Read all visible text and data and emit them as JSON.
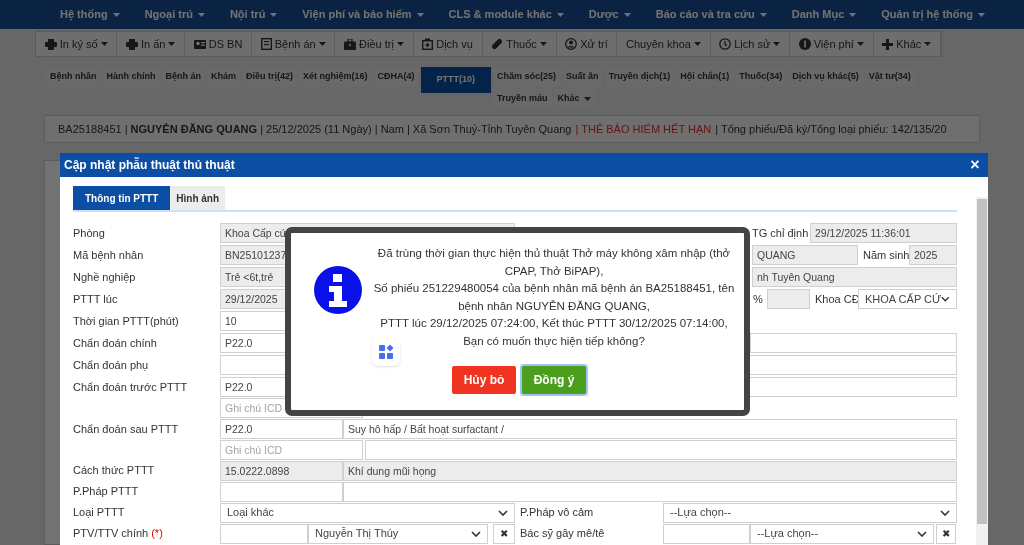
{
  "menu": [
    {
      "label": "Hệ thống"
    },
    {
      "label": "Ngoại trú"
    },
    {
      "label": "Nội trú"
    },
    {
      "label": "Viện phí và bảo hiểm"
    },
    {
      "label": "CLS & module khác"
    },
    {
      "label": "Dược"
    },
    {
      "label": "Báo cáo và tra cứu"
    },
    {
      "label": "Danh Mục"
    },
    {
      "label": "Quản trị hệ thống"
    }
  ],
  "toolbar": [
    {
      "label": "In ký số",
      "dropdown": true
    },
    {
      "label": "In ấn",
      "dropdown": true
    },
    {
      "label": "DS BN",
      "dropdown": false
    },
    {
      "label": "Bệnh án",
      "dropdown": true
    },
    {
      "label": "Điều trị",
      "dropdown": true
    },
    {
      "label": "Dịch vụ",
      "dropdown": false
    },
    {
      "label": "Thuốc",
      "dropdown": true
    },
    {
      "label": "Xử trí",
      "dropdown": false
    },
    {
      "label": "Chuyên khoa",
      "dropdown": true
    },
    {
      "label": "Lịch sử",
      "dropdown": true
    },
    {
      "label": "Viện phí",
      "dropdown": true
    },
    {
      "label": "Khác",
      "dropdown": true
    }
  ],
  "record_tabs": [
    {
      "label": "Bệnh nhân",
      "selected": false,
      "dropdown": false
    },
    {
      "label": "Hành chính",
      "selected": false,
      "dropdown": false
    },
    {
      "label": "Bệnh án",
      "selected": false,
      "dropdown": false
    },
    {
      "label": "Khám",
      "selected": false,
      "dropdown": false
    },
    {
      "label": "Điều trị(42)",
      "selected": false,
      "dropdown": false
    },
    {
      "label": "Xét nghiệm(16)",
      "selected": false,
      "dropdown": false
    },
    {
      "label": "CĐHA(4)",
      "selected": false,
      "dropdown": false
    },
    {
      "label": "PTTT(10)",
      "selected": true,
      "dropdown": false
    },
    {
      "label": "Chăm sóc(25)",
      "selected": false,
      "dropdown": false
    },
    {
      "label": "Suất ăn",
      "selected": false,
      "dropdown": false
    },
    {
      "label": "Truyền dịch(1)",
      "selected": false,
      "dropdown": false
    },
    {
      "label": "Hội chẩn(1)",
      "selected": false,
      "dropdown": false
    },
    {
      "label": "Thuốc(34)",
      "selected": false,
      "dropdown": false
    },
    {
      "label": "Dịch vụ khác(5)",
      "selected": false,
      "dropdown": false
    },
    {
      "label": "Vật tư(34)",
      "selected": false,
      "dropdown": false
    },
    {
      "label": "Truyền máu",
      "selected": false,
      "dropdown": false
    },
    {
      "label": "Khác",
      "selected": false,
      "dropdown": true
    }
  ],
  "patient_bar": {
    "info": "BA25188451 | **NGUYỄN ĐĂNG QUANG** | 25/12/2025 (11 Ngày) | Nam | Xã Sơn Thuỷ-Tỉnh Tuyên Quang",
    "warning": "| THẺ BẢO HIỂM HẾT HẠN",
    "totals": "| Tổng phiếu/Đã ký/Tổng loại phiếu: 142/135/20"
  },
  "modal": {
    "title": "Cập nhật phẫu thuật thủ thuật",
    "close": "×",
    "tabs": [
      {
        "label": "Thông tin PTTT",
        "selected": true
      },
      {
        "label": "Hình ảnh",
        "selected": false
      }
    ],
    "form": [
      {
        "label": "Phòng",
        "cells": [
          {
            "kind": "input",
            "value": "Khoa Cấp cứ",
            "readonly": true
          },
          {
            "kind": "label",
            "text": "TG chỉ định"
          },
          {
            "kind": "input",
            "value": "29/12/2025 11:36:01",
            "readonly": true
          }
        ]
      },
      {
        "label": "Mã bệnh nhân",
        "cells": [
          {
            "kind": "input",
            "value": "BN25101237",
            "readonly": true
          },
          {
            "kind": "input",
            "value": "QUANG",
            "readonly": true
          },
          {
            "kind": "label",
            "text": "Năm sinh"
          },
          {
            "kind": "input",
            "value": "2025",
            "readonly": true
          }
        ]
      },
      {
        "label": "Nghề nghiệp",
        "cells": [
          {
            "kind": "input",
            "value": "Trẻ <6t,trẻ",
            "readonly": true
          },
          {
            "kind": "input",
            "value": "nh Tuyên Quang",
            "readonly": true
          }
        ]
      },
      {
        "label": "PTTT lúc",
        "cells": [
          {
            "kind": "input",
            "value": "29/12/2025",
            "readonly": true
          },
          {
            "kind": "label",
            "text": "%"
          },
          {
            "kind": "input",
            "readonly": true
          },
          {
            "kind": "label",
            "text": "Khoa CĐ"
          },
          {
            "kind": "select",
            "value": "KHOA CẤP CỨ"
          }
        ]
      },
      {
        "label": "Thời gian PTTT(phút)",
        "cells": [
          {
            "kind": "input",
            "value": "10",
            "readonly": false
          }
        ]
      },
      {
        "label": "Chẩn đoán chính",
        "cells": [
          {
            "kind": "input",
            "value": "P22.0",
            "readonly": false
          },
          {
            "kind": "input",
            "readonly": false
          }
        ]
      },
      {
        "label": "Chẩn đoán phụ",
        "cells": [
          {
            "kind": "input",
            "readonly": false
          }
        ]
      },
      {
        "label": "Chẩn đoán trước PTTT",
        "cells": [
          {
            "kind": "input",
            "value": "P22.0",
            "readonly": false
          },
          {
            "kind": "input",
            "readonly": false
          }
        ]
      },
      {
        "cells": [
          {
            "kind": "input",
            "placeholder": "Ghi chú ICD",
            "readonly": false
          }
        ]
      },
      {
        "label": "Chẩn đoán sau PTTT",
        "cells": [
          {
            "kind": "input",
            "value": "P22.0",
            "readonly": false
          },
          {
            "kind": "input",
            "value": "Suy hô hấp / Bất hoạt surfactant /",
            "readonly": false
          }
        ]
      },
      {
        "cells": [
          {
            "kind": "input",
            "placeholder": "Ghi chú ICD",
            "readonly": false
          },
          {
            "kind": "input",
            "readonly": false
          }
        ]
      },
      {
        "label": "Cách thức PTTT",
        "cells": [
          {
            "kind": "input",
            "value": "15.0222.0898",
            "readonly": true
          },
          {
            "kind": "input",
            "value": "Khí dung mũi họng",
            "readonly": true
          }
        ]
      },
      {
        "label": "P.Pháp PTTT",
        "cells": [
          {
            "kind": "input",
            "readonly": false
          },
          {
            "kind": "input",
            "readonly": false
          }
        ]
      },
      {
        "label": "Loại PTTT",
        "cells": [
          {
            "kind": "select",
            "value": "Loại khác"
          },
          {
            "kind": "label",
            "text": "P.Pháp vô cảm"
          },
          {
            "kind": "select",
            "value": "--Lựa chọn--"
          }
        ]
      },
      {
        "label": "PTV/TTV chính",
        "required_mark": "(*)",
        "cells": [
          {
            "kind": "input",
            "readonly": false
          },
          {
            "kind": "select",
            "value": "Nguyễn Thị Thúy"
          },
          {
            "kind": "clear",
            "text": "✖"
          },
          {
            "kind": "label",
            "text": "Bác sỹ gây mê/tê"
          },
          {
            "kind": "input",
            "readonly": false
          },
          {
            "kind": "select",
            "value": "--Lựa chọn--"
          },
          {
            "kind": "clear",
            "text": "✖"
          }
        ]
      }
    ]
  },
  "confirm_dialog": {
    "message": "Đã trùng thời gian thực hiện thủ thuật Thở máy không xâm nhập (thở CPAP, Thở BiPAP),\nSố phiếu 251229480054 của bệnh nhân mã bệnh án BA25188451, tên bệnh nhân NGUYỄN ĐĂNG QUANG,\nPTTT lúc 29/12/2025 07:24:00, Kết thúc PTTT 30/12/2025 07:14:00,\nBạn có muốn thực hiện tiếp không?",
    "buttons": [
      {
        "label": "Hủy bỏ",
        "kind": "cancel"
      },
      {
        "label": "Đồng ý",
        "kind": "confirm"
      }
    ]
  }
}
